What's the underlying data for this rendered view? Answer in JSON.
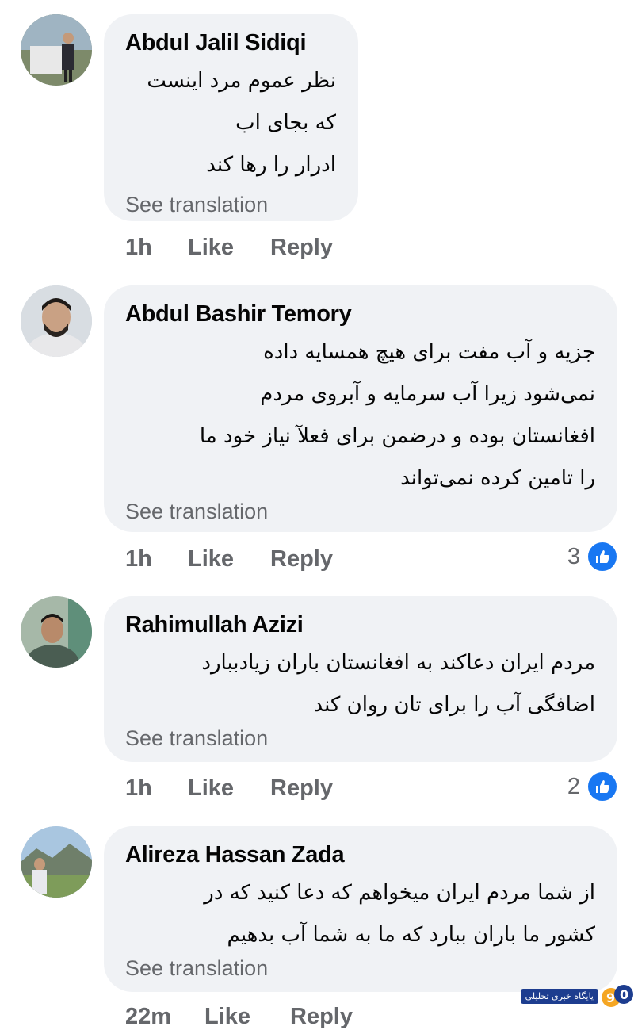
{
  "comments": [
    {
      "author": "Abdul Jalil Sidiqi",
      "lines": [
        "نظر عموم مرد اینست",
        "که بجای اب",
        "ادرار را رها کند"
      ],
      "see_translation": "See translation",
      "time": "1h",
      "like": "Like",
      "reply": "Reply",
      "reactions": ""
    },
    {
      "author": "Abdul Bashir Temory",
      "lines": [
        "جزیه و آب مفت برای هیچ همسایه داده",
        "نمی‌شود زیرا  آب سرمایه و  آبروی مردم",
        "افغانستان بوده و درضمن برای فعلآ نیاز خود ما",
        "را تامین کرده نمی‌تواند"
      ],
      "see_translation": "See translation",
      "time": "1h",
      "like": "Like",
      "reply": "Reply",
      "reactions": "3"
    },
    {
      "author": "Rahimullah Azizi",
      "lines": [
        "مردم ایران دعاکند به افغانستان باران زیادببارد",
        "اضافگی آب را برای تان روان کند"
      ],
      "see_translation": "See translation",
      "time": "1h",
      "like": "Like",
      "reply": "Reply",
      "reactions": "2"
    },
    {
      "author": "Alireza Hassan Zada",
      "lines": [
        "از شما مردم ایران میخواهم که دعا کنید که در",
        "کشور ما باران ببارد که ما به شما آب بدهیم"
      ],
      "see_translation": "See translation",
      "time": "22m",
      "like": "Like",
      "reply": "Reply",
      "reactions": ""
    }
  ],
  "watermark": {
    "text": "پایگاه خبری تحلیلی"
  },
  "colors": {
    "bubble": "#f0f2f5",
    "meta": "#65676b",
    "like_blue": "#1877f2"
  }
}
